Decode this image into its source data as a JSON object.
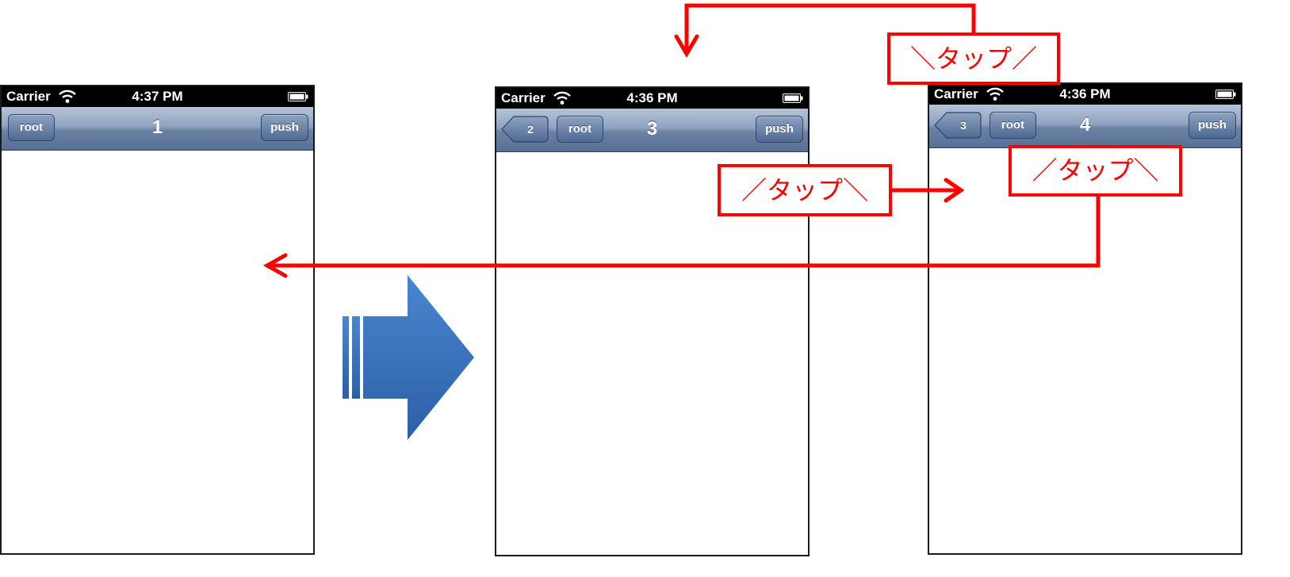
{
  "screens": [
    {
      "status": {
        "carrier": "Carrier",
        "time": "4:37 PM"
      },
      "nav": {
        "title": "1",
        "left_button": "root",
        "right_button": "push"
      }
    },
    {
      "status": {
        "carrier": "Carrier",
        "time": "4:36 PM"
      },
      "nav": {
        "title": "3",
        "back_button": "2",
        "left_button": "root",
        "right_button": "push"
      }
    },
    {
      "status": {
        "carrier": "Carrier",
        "time": "4:36 PM"
      },
      "nav": {
        "title": "4",
        "back_button": "3",
        "left_button": "root",
        "right_button": "push"
      }
    }
  ],
  "annotations": {
    "tap_top": "＼タップ／",
    "tap_middle": "／タップ＼",
    "tap_right": "／タップ＼"
  },
  "colors": {
    "annotation": "#ff0000",
    "transition_arrow": "#3b74bf",
    "navbar_dark": "#566f95",
    "navbar_light": "#b6c4d8"
  },
  "icons": [
    "wifi-icon",
    "battery-icon",
    "back-chevron-icon",
    "transition-arrow-icon",
    "annotation-arrow-icon"
  ]
}
